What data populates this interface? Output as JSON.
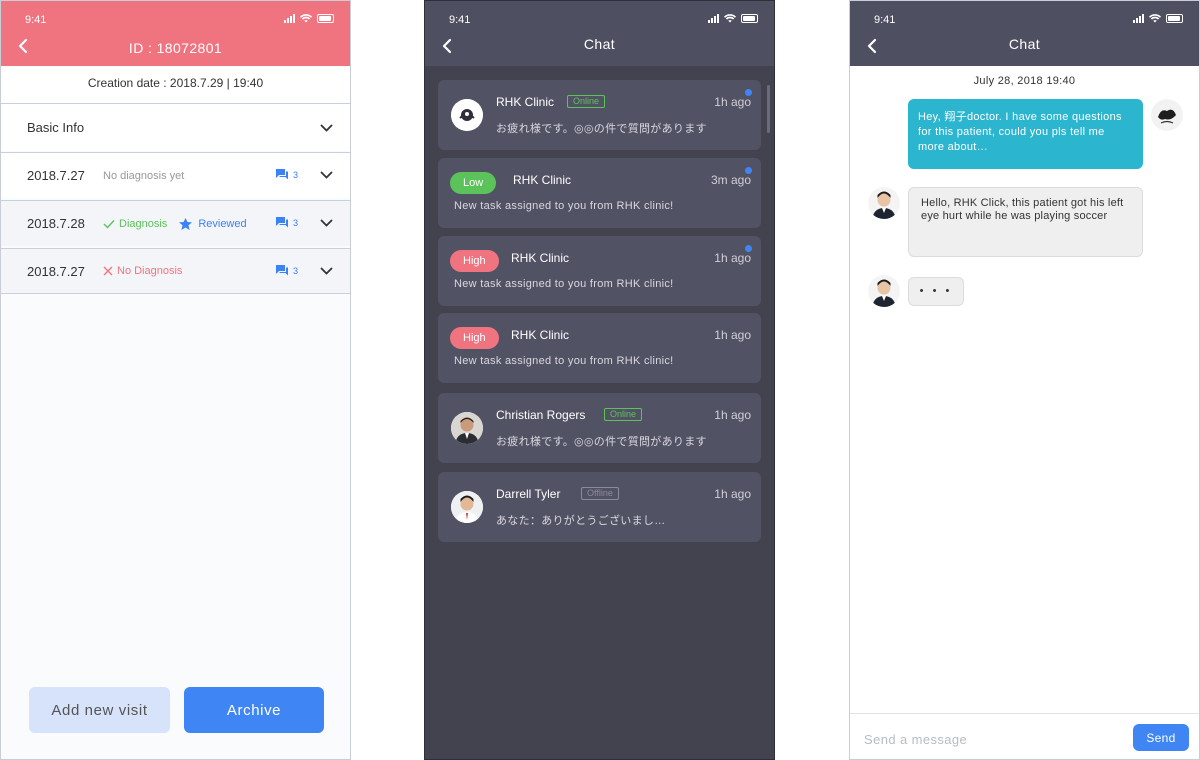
{
  "colors": {
    "accent_red": "#ef7480",
    "accent_blue": "#3f86f4",
    "accent_green": "#5cc25a",
    "chat_out": "#2bb5cf",
    "dark_bg": "#43424f",
    "dark_card": "#525265"
  },
  "status_time": "9:41",
  "visit_screen": {
    "title": "ID : 18072801",
    "creation": "Creation date : 2018.7.29 | 19:40",
    "basic_info": "Basic Info",
    "rows": [
      {
        "date": "2018.7.27",
        "status": "No diagnosis yet",
        "comments": "3"
      },
      {
        "date": "2018.7.28",
        "status": "Diagnosis",
        "reviewed": "Reviewed",
        "comments": "3"
      },
      {
        "date": "2018.7.27",
        "status": "No Diagnosis",
        "comments": "3"
      }
    ],
    "add_button": "Add new visit",
    "archive_button": "Archive"
  },
  "chat_list": {
    "title": "Chat",
    "items": [
      {
        "name": "RHK Clinic",
        "badge": "Online",
        "time": "1h ago",
        "message": "お疲れ様です。◎◎の件で質問があります",
        "avatar": "clinic-logo-icon"
      },
      {
        "pill": "Low",
        "name": "RHK Clinic",
        "time": "3m ago",
        "message": "New task assigned to you from RHK clinic!"
      },
      {
        "pill": "High",
        "name": "RHK Clinic",
        "time": "1h ago",
        "message": "New task assigned to you from RHK clinic!"
      },
      {
        "pill": "High",
        "name": "RHK Clinic",
        "time": "1h ago",
        "message": "New task assigned to you from RHK clinic!"
      },
      {
        "name": "Christian Rogers",
        "badge": "Online",
        "time": "1h ago",
        "message": "お疲れ様です。◎◎の件で質問があります",
        "avatar": "person-avatar"
      },
      {
        "name": "Darrell Tyler",
        "badge": "Offline",
        "time": "1h ago",
        "message": "あなた：ありがとうございまし…",
        "avatar": "person-avatar"
      }
    ]
  },
  "chat_room": {
    "title": "Chat",
    "date": "July 28, 2018 19:40",
    "outgoing": "Hey, 翔子doctor. I have some questions for this patient, could you pls tell me more about…",
    "incoming": "Hello, RHK Click, this patient got his left eye hurt while he was playing soccer",
    "typing": "• • •",
    "input_placeholder": "Send a message",
    "send_button": "Send"
  }
}
